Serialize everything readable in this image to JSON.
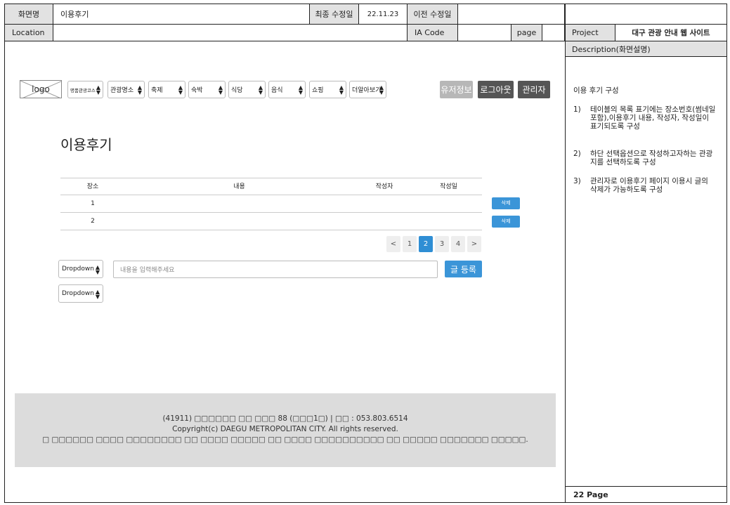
{
  "header": {
    "screen_name_label": "화면명",
    "screen_name": "이용후기",
    "last_modified_label": "최종 수정일",
    "last_modified": "22.11.23",
    "prev_modified_label": "이전 수정일",
    "prev_modified": "",
    "location_label": "Location",
    "location": "",
    "ia_code_label": "IA Code",
    "ia_code": "",
    "page_label": "page",
    "page": "",
    "project_label": "Project",
    "project": "대구 관광 안내 웹 사이트"
  },
  "nav": {
    "logo": "logo",
    "selects": [
      "명품관광코스",
      "관광명소",
      "축제",
      "숙박",
      "식당",
      "음식",
      "쇼핑",
      "더알아보기"
    ],
    "buttons": {
      "user_info": "유저정보",
      "logout": "로그아웃",
      "admin": "관리자"
    },
    "colors": {
      "user_info": "#b7b7b7",
      "dark": "#555555"
    }
  },
  "page": {
    "title": "이용후기"
  },
  "table": {
    "columns": [
      "장소",
      "내용",
      "작성자",
      "작성일"
    ],
    "rows": [
      {
        "place": "1",
        "content": "",
        "author": "",
        "date": ""
      },
      {
        "place": "2",
        "content": "",
        "author": "",
        "date": ""
      }
    ],
    "delete_label": "삭제"
  },
  "pagination": {
    "prev": "<",
    "pages": [
      "1",
      "2",
      "3",
      "4"
    ],
    "current": "2",
    "next": ">"
  },
  "form": {
    "dropdown1": "Dropdown",
    "dropdown2": "Dropdown",
    "input_placeholder": "내용을 입력해주세요",
    "submit": "글 등록",
    "accent_color": "#3b95d8"
  },
  "footer": {
    "line1": "(41911) □□□□□□ □□ □□□ 88 (□□□1□) | □□ : 053.803.6514",
    "line2": "Copyright(c) DAEGU METROPOLITAN CITY. All rights reserved.",
    "line3": "□ □□□□□□ □□□□ □□□□□□□□ □□ □□□□ □□□□□ □□ □□□□ □□□□□□□□□□ □□ □□□□□ □□□□□□□ □□□□□."
  },
  "description": {
    "label": "Description(화면설명)",
    "heading": "이용 후기 구성",
    "notes": [
      {
        "num": "1)",
        "text": "테이블의 목록 표기에는 장소번호(썸네일포함),이용후기 내용, 작성자, 작성일이 표기되도록 구성"
      },
      {
        "num": "2)",
        "text": "하단 선택옵션으로 작성하고자하는 관광지를 선택하도록 구성"
      },
      {
        "num": "3)",
        "text": "관리자로 이용후기 페이지 이용시 글의 삭제가 가능하도록 구성"
      }
    ],
    "page_number": "22 Page"
  }
}
